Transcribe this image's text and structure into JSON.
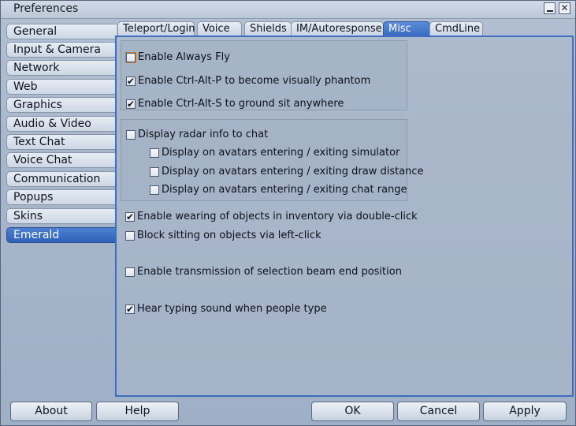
{
  "window": {
    "title": "Preferences",
    "minimize_icon": "minimize-icon",
    "close_icon": "close-icon",
    "close_glyph": "✕"
  },
  "sidebar": {
    "items": [
      {
        "label": "General",
        "active": false
      },
      {
        "label": "Input & Camera",
        "active": false
      },
      {
        "label": "Network",
        "active": false
      },
      {
        "label": "Web",
        "active": false
      },
      {
        "label": "Graphics",
        "active": false
      },
      {
        "label": "Audio & Video",
        "active": false
      },
      {
        "label": "Text Chat",
        "active": false
      },
      {
        "label": "Voice Chat",
        "active": false
      },
      {
        "label": "Communication",
        "active": false
      },
      {
        "label": "Popups",
        "active": false
      },
      {
        "label": "Skins",
        "active": false
      },
      {
        "label": "Emerald",
        "active": true
      }
    ]
  },
  "tabs": [
    {
      "label": "Teleport/Login",
      "active": false
    },
    {
      "label": "Voice",
      "active": false
    },
    {
      "label": "Shields",
      "active": false
    },
    {
      "label": "IM/Autoresponse",
      "active": false
    },
    {
      "label": "Misc",
      "active": true
    },
    {
      "label": "CmdLine",
      "active": false
    }
  ],
  "misc": {
    "always_fly": {
      "label": "Enable Always Fly",
      "checked": false
    },
    "phantom": {
      "label": "Enable Ctrl-Alt-P to become visually phantom",
      "checked": true
    },
    "ground_sit": {
      "label": "Enable Ctrl-Alt-S to ground sit anywhere",
      "checked": true
    },
    "radar_chat": {
      "label": "Display radar info to chat",
      "checked": false
    },
    "radar_sim": {
      "label": "Display on avatars entering / exiting simulator",
      "checked": false
    },
    "radar_draw": {
      "label": "Display on avatars entering / exiting draw distance",
      "checked": false
    },
    "radar_range": {
      "label": "Display on avatars entering / exiting chat range",
      "checked": false
    },
    "double_click_wear": {
      "label": "Enable wearing of objects in inventory via double-click",
      "checked": true
    },
    "block_sit": {
      "label": "Block sitting on objects via left-click",
      "checked": false
    },
    "beam_transmit": {
      "label": "Enable transmission of selection beam end position",
      "checked": false
    },
    "typing_sound": {
      "label": "Hear typing sound when people type",
      "checked": true
    }
  },
  "buttons": {
    "about": "About",
    "help": "Help",
    "ok": "OK",
    "cancel": "Cancel",
    "apply": "Apply"
  },
  "check_glyph": "✔",
  "colors": {
    "accent": "#3f6fc0",
    "active_item": "#2f62b8",
    "panel_bg": "#aab7ca"
  }
}
